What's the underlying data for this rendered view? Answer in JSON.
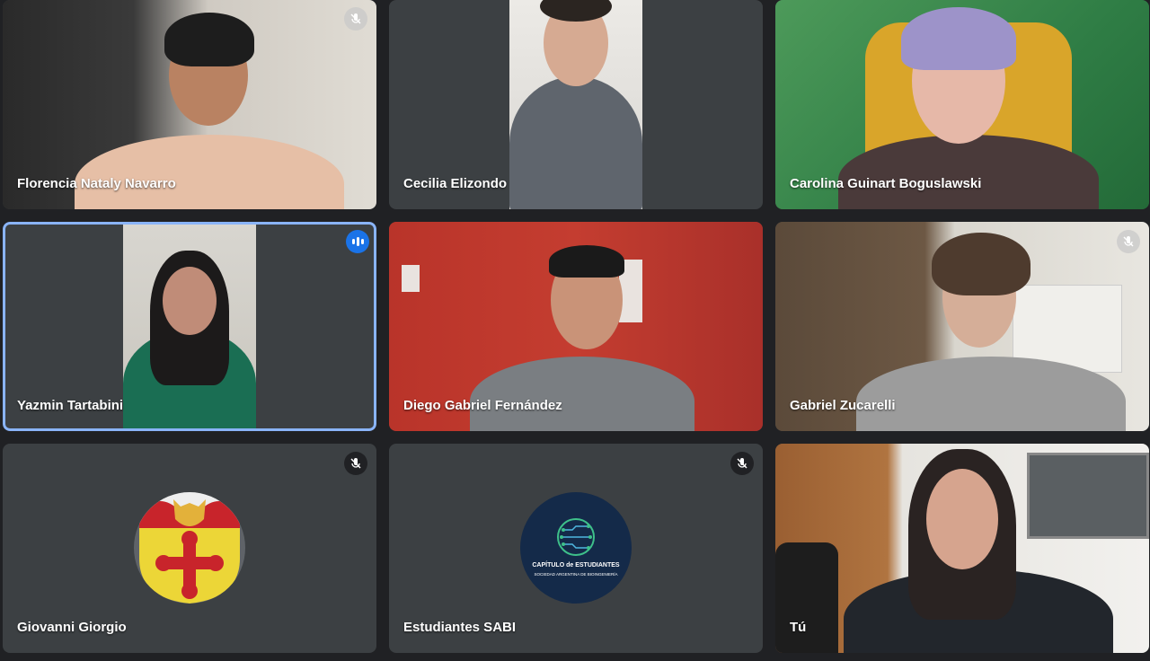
{
  "participants": [
    {
      "name": "Florencia Nataly Navarro",
      "muted": true
    },
    {
      "name": "Cecilia Elizondo",
      "muted": false
    },
    {
      "name": "Carolina Guinart Boguslawski",
      "muted": false
    },
    {
      "name": "Yazmin Tartabini",
      "muted": false,
      "speaking": true
    },
    {
      "name": "Diego Gabriel Fernández",
      "muted": false
    },
    {
      "name": "Gabriel Zucarelli",
      "muted": true
    },
    {
      "name": "Giovanni Giorgio",
      "muted": true,
      "avatar": "shield-avatar"
    },
    {
      "name": "Estudiantes SABI",
      "muted": true,
      "avatar": "logo-avatar"
    },
    {
      "name": "Tú",
      "muted": false
    }
  ],
  "logo": {
    "line1": "CAPÍTULO de ESTUDIANTES",
    "line2": "SOCIEDAD ARGENTINA DE BIOINGENIERÍA"
  },
  "colors": {
    "tile_bg": "#3c4043",
    "page_bg": "#202124",
    "speaking_blue": "#1a73e8",
    "active_border": "#8ab4f8"
  }
}
